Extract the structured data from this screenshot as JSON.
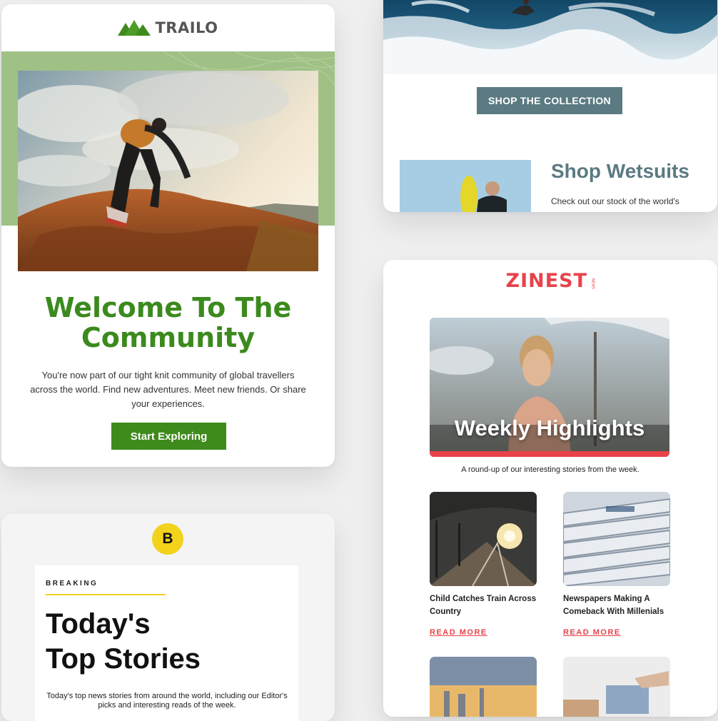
{
  "trailo": {
    "brand": "TRAILO",
    "title_line1": "Welcome To The",
    "title_line2": "Community",
    "body": "You're now part of our tight knit community of global travellers across the world. Find new adventures. Meet new friends. Or share your experiences.",
    "cta": "Start Exploring",
    "colors": {
      "accent": "#3f8a1d",
      "band": "#9fc185"
    }
  },
  "surf": {
    "cta": "SHOP THE COLLECTION",
    "section_title": "Shop Wetsuits",
    "section_text": "Check out our stock of the world's",
    "colors": {
      "accent": "#5b7a82"
    }
  },
  "zinest": {
    "brand": "ZINEST",
    "brand_sub": "NEWS",
    "hero_title": "Weekly Highlights",
    "subtitle": "A round-up of our interesting stories from the week.",
    "stories": [
      {
        "title": "Child Catches Train Across Country",
        "link": "READ MORE"
      },
      {
        "title": "Newspapers Making A Comeback With Millenials",
        "link": "READ MORE"
      }
    ],
    "colors": {
      "accent": "#e8424a"
    }
  },
  "bnews": {
    "logo": "B",
    "label": "BREAKING",
    "title_line1": "Today's",
    "title_line2": "Top Stories",
    "body": "Today's top news stories from around the world, including our Editor's picks and interesting reads of the week.",
    "colors": {
      "accent": "#f3d21c"
    }
  }
}
